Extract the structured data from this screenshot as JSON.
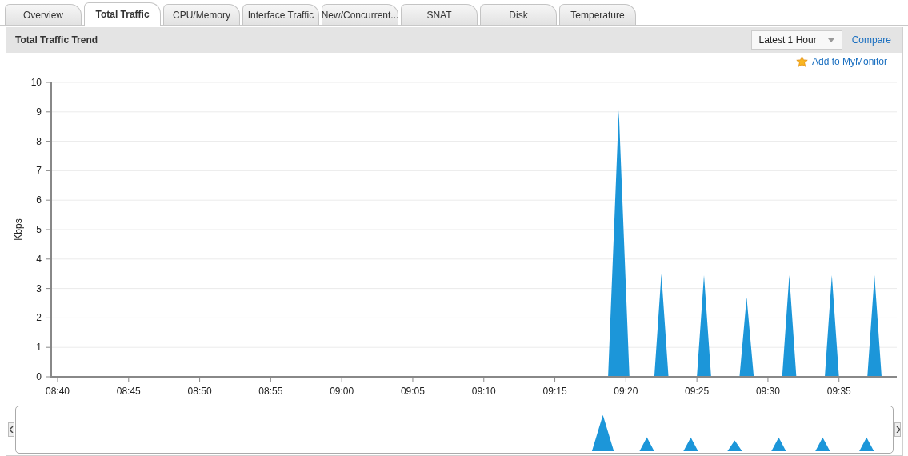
{
  "tabs": [
    {
      "label": "Overview",
      "selected": false
    },
    {
      "label": "Total Traffic",
      "selected": true
    },
    {
      "label": "CPU/Memory",
      "selected": false
    },
    {
      "label": "Interface Traffic",
      "selected": false
    },
    {
      "label": "New/Concurrent...",
      "selected": false
    },
    {
      "label": "SNAT",
      "selected": false
    },
    {
      "label": "Disk",
      "selected": false
    },
    {
      "label": "Temperature",
      "selected": false
    }
  ],
  "panel": {
    "title": "Total Traffic Trend",
    "time_range": "Latest 1 Hour",
    "compare_link": "Compare",
    "add_link": "Add to MyMonitor"
  },
  "chart_data": {
    "type": "area",
    "ylabel": "Kbps",
    "grid": true,
    "x": [
      520,
      558.75,
      559.5,
      560.25,
      562,
      562.5,
      563,
      565,
      565.5,
      566,
      568,
      568.5,
      569,
      571,
      571.5,
      572,
      574,
      574.5,
      575,
      577,
      577.5,
      578
    ],
    "series": [
      {
        "color": "#1c96d9",
        "values": [
          0,
          0,
          9.05,
          0,
          0,
          3.5,
          0,
          0,
          3.45,
          0,
          0,
          2.7,
          0,
          0,
          3.45,
          0,
          0,
          3.45,
          0,
          0,
          3.45,
          0
        ]
      }
    ],
    "xlim": [
      519.55,
      579.07
    ],
    "ylim": [
      0,
      10
    ],
    "xticks": [
      {
        "value": 520,
        "label": "08:40"
      },
      {
        "value": 525,
        "label": "08:45"
      },
      {
        "value": 530,
        "label": "08:50"
      },
      {
        "value": 535,
        "label": "08:55"
      },
      {
        "value": 540,
        "label": "09:00"
      },
      {
        "value": 545,
        "label": "09:05"
      },
      {
        "value": 550,
        "label": "09:10"
      },
      {
        "value": 555,
        "label": "09:15"
      },
      {
        "value": 560,
        "label": "09:20"
      },
      {
        "value": 565,
        "label": "09:25"
      },
      {
        "value": 570,
        "label": "09:30"
      },
      {
        "value": 575,
        "label": "09:35"
      }
    ],
    "yticks": [
      0,
      1,
      2,
      3,
      4,
      5,
      6,
      7,
      8,
      9,
      10
    ]
  }
}
